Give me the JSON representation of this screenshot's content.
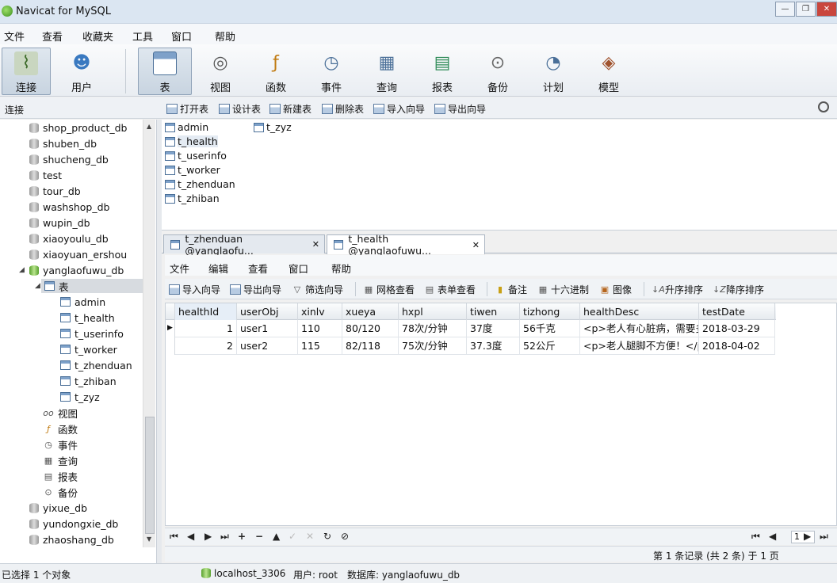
{
  "window": {
    "title": "Navicat for MySQL"
  },
  "menu": [
    "文件",
    "查看",
    "收藏夹",
    "工具",
    "窗口",
    "帮助"
  ],
  "toolbar": {
    "buttons": [
      {
        "label": "连接",
        "icon": "connection-icon"
      },
      {
        "label": "用户",
        "icon": "user-icon"
      },
      {
        "label": "表",
        "icon": "table-icon"
      },
      {
        "label": "视图",
        "icon": "view-icon"
      },
      {
        "label": "函数",
        "icon": "function-icon"
      },
      {
        "label": "事件",
        "icon": "event-icon"
      },
      {
        "label": "查询",
        "icon": "query-icon"
      },
      {
        "label": "报表",
        "icon": "report-icon"
      },
      {
        "label": "备份",
        "icon": "backup-icon"
      },
      {
        "label": "计划",
        "icon": "schedule-icon"
      },
      {
        "label": "模型",
        "icon": "model-icon"
      }
    ]
  },
  "subbar": {
    "section": "连接",
    "actions": [
      "打开表",
      "设计表",
      "新建表",
      "删除表",
      "导入向导",
      "导出向导"
    ]
  },
  "sidebar": {
    "databases_before": [
      "shop_product_db",
      "shuben_db",
      "shucheng_db",
      "test",
      "tour_db",
      "washshop_db",
      "wupin_db",
      "xiaoyoulu_db",
      "xiaoyuan_ershou"
    ],
    "open_db": "yanglaofuwu_db",
    "tables_node": "表",
    "tables": [
      "admin",
      "t_health",
      "t_userinfo",
      "t_worker",
      "t_zhenduan",
      "t_zhiban",
      "t_zyz"
    ],
    "other_nodes": [
      "视图",
      "函数",
      "事件",
      "查询",
      "报表",
      "备份"
    ],
    "databases_after": [
      "yixue_db",
      "yundongxie_db",
      "zhaoshang_db"
    ]
  },
  "objects": [
    "admin",
    "t_health",
    "t_userinfo",
    "t_worker",
    "t_zhenduan",
    "t_zhiban",
    "t_zyz"
  ],
  "tabs": [
    {
      "label": "t_zhenduan @yanglaofu..."
    },
    {
      "label": "t_health @yanglaofuwu..."
    }
  ],
  "inner_menu": [
    "文件",
    "编辑",
    "查看",
    "窗口",
    "帮助"
  ],
  "inner_toolbar": [
    "导入向导",
    "导出向导",
    "筛选向导",
    "网格查看",
    "表单查看",
    "备注",
    "十六进制",
    "图像",
    "升序排序",
    "降序排序"
  ],
  "grid": {
    "columns": [
      "healthId",
      "userObj",
      "xinlv",
      "xueya",
      "hxpl",
      "tiwen",
      "tizhong",
      "healthDesc",
      "testDate"
    ],
    "rows": [
      [
        "1",
        "user1",
        "110",
        "80/120",
        "78次/分钟",
        "37度",
        "56千克",
        "<p>老人有心脏病，需要多",
        "2018-03-29"
      ],
      [
        "2",
        "user2",
        "115",
        "82/118",
        "75次/分钟",
        "37.3度",
        "52公斤",
        "<p>老人腿脚不方便！</p",
        "2018-04-02"
      ]
    ]
  },
  "pager": {
    "page": "1"
  },
  "record_info": "第 1 条记录 (共 2 条) 于 1 页",
  "status": {
    "selection": "已选择 1 个对象",
    "connection": "localhost_3306",
    "user": "用户: root",
    "database": "数据库: yanglaofuwu_db"
  }
}
